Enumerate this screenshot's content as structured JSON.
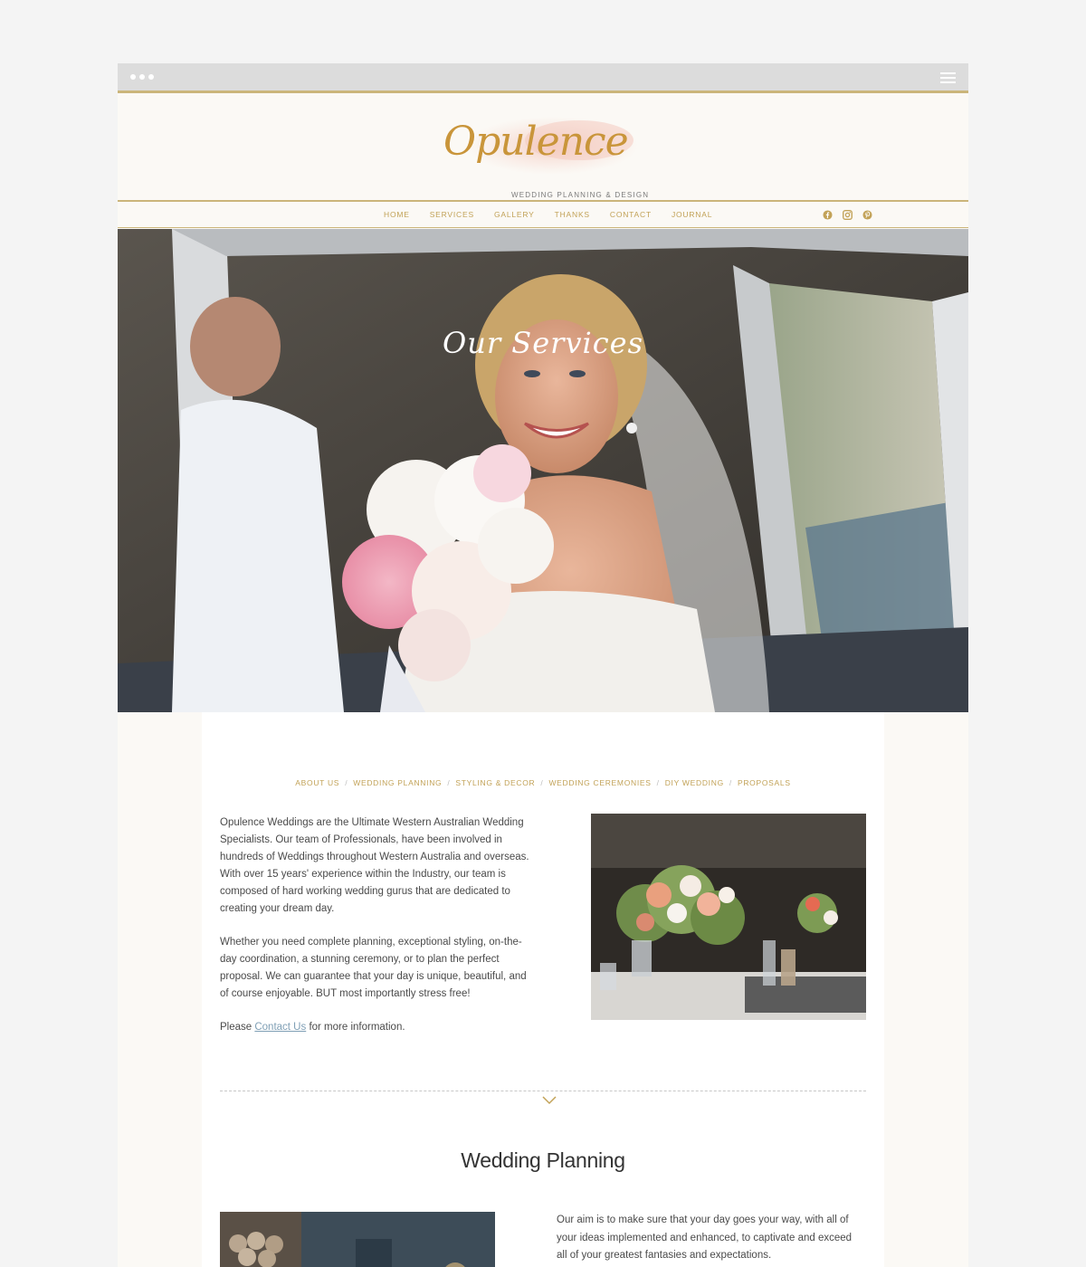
{
  "brand": {
    "name": "Opulence",
    "tagline": "WEDDING PLANNING & DESIGN"
  },
  "nav": {
    "items": [
      "HOME",
      "SERVICES",
      "GALLERY",
      "THANKS",
      "CONTACT",
      "JOURNAL"
    ],
    "social": [
      "facebook-icon",
      "instagram-icon",
      "pinterest-icon"
    ]
  },
  "hero": {
    "title": "Our Services"
  },
  "subnav": {
    "items": [
      "ABOUT US",
      "WEDDING PLANNING",
      "STYLING & DECOR",
      "WEDDING CEREMONIES",
      "DIY WEDDING",
      "PROPOSALS"
    ],
    "separator": "/"
  },
  "intro": {
    "p1": "Opulence Weddings are the Ultimate Western Australian Wedding Specialists. Our team of Professionals, have been involved in hundreds of Weddings throughout Western Australia and overseas. With over 15 years' experience within the Industry, our team is composed of hard working wedding gurus that are dedicated to creating your dream day.",
    "p2": "Whether you need complete planning, exceptional styling, on-the-day coordination, a stunning ceremony, or to plan the perfect proposal. We can guarantee that your day is unique, beautiful, and of course enjoyable. BUT most importantly stress free!",
    "p3_before": "Please ",
    "p3_link": "Contact Us",
    "p3_after": " for more information."
  },
  "planning": {
    "title": "Wedding Planning",
    "text": "Our aim is to make sure that your day goes your way, with all of your ideas implemented and enhanced, to captivate and exceed all of your greatest fantasies and expectations."
  },
  "colors": {
    "gold": "#c2a257",
    "cream": "#fbf9f5",
    "chrome": "#dcdcdc"
  }
}
